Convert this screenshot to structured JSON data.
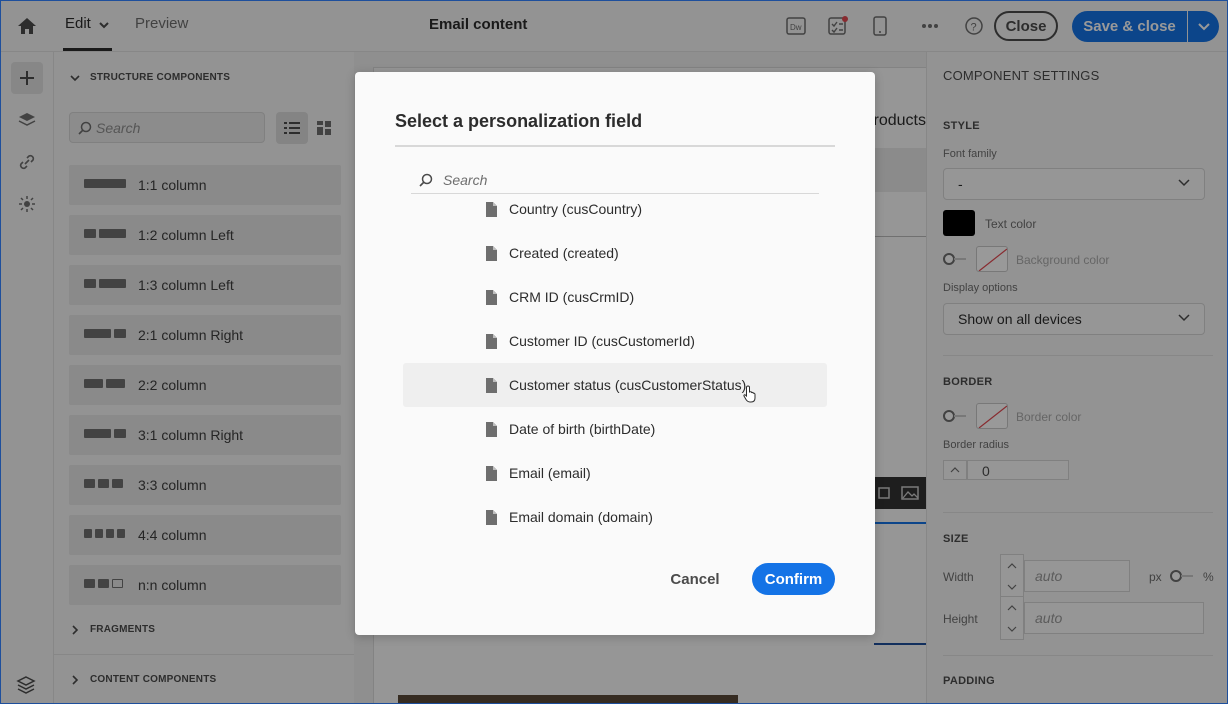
{
  "topbar": {
    "tab_edit": "Edit",
    "tab_preview": "Preview",
    "title": "Email content",
    "close_label": "Close",
    "save_label": "Save & close"
  },
  "left_panel": {
    "structure_header": "STRUCTURE COMPONENTS",
    "search_placeholder": "Search",
    "components": [
      {
        "label": "1:1 column"
      },
      {
        "label": "1:2 column Left"
      },
      {
        "label": "1:3 column Left"
      },
      {
        "label": "2:1 column Right"
      },
      {
        "label": "2:2 column"
      },
      {
        "label": "3:1 column Right"
      },
      {
        "label": "3:3 column"
      },
      {
        "label": "4:4 column"
      },
      {
        "label": "n:n column"
      }
    ],
    "fragments_header": "FRAGMENTS",
    "content_header": "CONTENT COMPONENTS"
  },
  "canvas": {
    "products_text": "Products"
  },
  "right_panel": {
    "title": "COMPONENT SETTINGS",
    "style_header": "STYLE",
    "font_family_label": "Font family",
    "font_family_value": "-",
    "text_color_label": "Text color",
    "text_color_value": "#000000",
    "bg_color_label": "Background color",
    "display_options_label": "Display options",
    "display_options_value": "Show on all devices",
    "border_header": "BORDER",
    "border_color_label": "Border color",
    "border_radius_label": "Border radius",
    "border_radius_value": "0",
    "size_header": "SIZE",
    "width_label": "Width",
    "width_placeholder": "auto",
    "px_label": "px",
    "pct_label": "%",
    "height_label": "Height",
    "height_placeholder": "auto",
    "padding_header": "PADDING"
  },
  "modal": {
    "title": "Select a personalization field",
    "search_placeholder": "Search",
    "fields": [
      {
        "label": "Country (cusCountry)"
      },
      {
        "label": "Created (created)"
      },
      {
        "label": "CRM ID (cusCrmID)"
      },
      {
        "label": "Customer ID (cusCustomerId)"
      },
      {
        "label": "Customer status (cusCustomerStatus)",
        "hovered": true
      },
      {
        "label": "Date of birth (birthDate)"
      },
      {
        "label": "Email (email)"
      },
      {
        "label": "Email domain (domain)"
      }
    ],
    "cancel_label": "Cancel",
    "confirm_label": "Confirm"
  },
  "colors": {
    "accent": "#1473e6",
    "overlay": "rgba(0,0,0,0.4)"
  }
}
